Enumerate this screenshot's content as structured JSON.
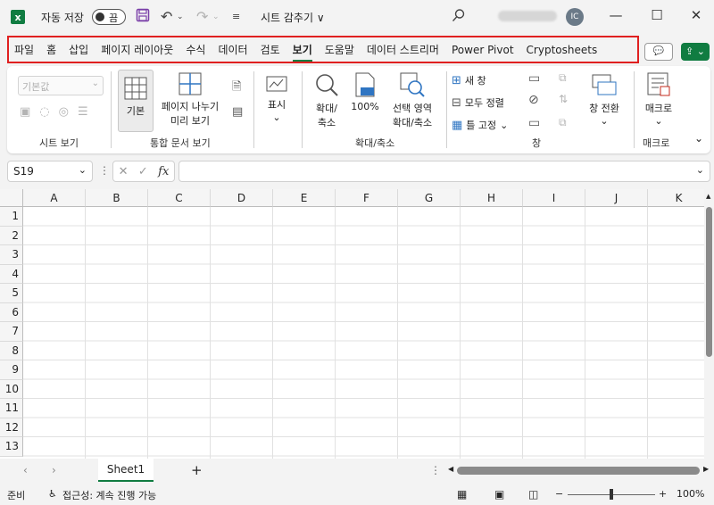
{
  "titlebar": {
    "autosave_label": "자동 저장",
    "autosave_state": "끔",
    "doc_title": "시트 감추기 ∨",
    "user_initials": "IC"
  },
  "tabs": [
    "파일",
    "홈",
    "삽입",
    "페이지 레이아웃",
    "수식",
    "데이터",
    "검토",
    "보기",
    "도움말",
    "데이터 스트리머",
    "Power Pivot",
    "Cryptosheets"
  ],
  "active_tab": "보기",
  "ribbon": {
    "sheet_view": {
      "dropdown_placeholder": "기본값",
      "group_label": "시트 보기"
    },
    "workbook_views": {
      "normal": "기본",
      "page_break_1": "페이지 나누기",
      "page_break_2": "미리 보기",
      "group_label": "통합 문서 보기"
    },
    "show": {
      "label": "표시"
    },
    "zoom": {
      "zoom_1": "확대/",
      "zoom_2": "축소",
      "hundred": "100%",
      "selection_1": "선택 영역",
      "selection_2": "확대/축소",
      "group_label": "확대/축소"
    },
    "window": {
      "new_window": "새 창",
      "arrange_all": "모두 정렬",
      "freeze": "틀 고정",
      "switch": "창 전환",
      "group_label": "창"
    },
    "macros": {
      "label": "매크로",
      "group_label": "매크로"
    }
  },
  "formula_bar": {
    "name_box": "S19",
    "fx": "fx"
  },
  "grid": {
    "columns": [
      "A",
      "B",
      "C",
      "D",
      "E",
      "F",
      "G",
      "H",
      "I",
      "J",
      "K"
    ],
    "rows": [
      "1",
      "2",
      "3",
      "4",
      "5",
      "6",
      "7",
      "8",
      "9",
      "10",
      "11",
      "12",
      "13"
    ]
  },
  "sheets": {
    "active": "Sheet1",
    "add": "+"
  },
  "status": {
    "ready": "준비",
    "accessibility": "접근성: 계속 진행 가능",
    "zoom": "100%"
  },
  "colors": {
    "accent": "#107c41",
    "highlight_border": "#e02020"
  }
}
